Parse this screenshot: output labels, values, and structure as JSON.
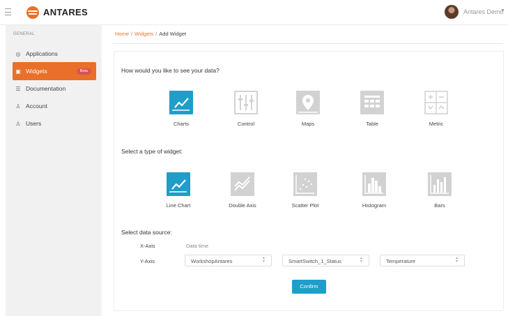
{
  "colors": {
    "accent": "#e8702a",
    "selected": "#1e9ec9",
    "icon_gray": "#d2d2d2",
    "badge": "#d9534f",
    "button": "#1e9ec9"
  },
  "header": {
    "brand": "ANTARES",
    "user": "Antares Demo"
  },
  "sidebar": {
    "heading": "GENERAL",
    "items": [
      {
        "label": "Applications",
        "icon": "applications-icon"
      },
      {
        "label": "Widgets",
        "icon": "widgets-icon",
        "badge": "Beta",
        "active": true
      },
      {
        "label": "Documentation",
        "icon": "documentation-icon"
      },
      {
        "label": "Account",
        "icon": "account-icon"
      },
      {
        "label": "Users",
        "icon": "users-icon"
      }
    ]
  },
  "breadcrumb": {
    "home": "Home",
    "widgets": "Widgets",
    "current": "Add Widget"
  },
  "main": {
    "question1": "How would you like to see your data?",
    "data_views": [
      {
        "label": "Charts",
        "icon": "line-chart-icon",
        "selected": true
      },
      {
        "label": "Control",
        "icon": "sliders-icon",
        "selected": false
      },
      {
        "label": "Maps",
        "icon": "map-pin-icon",
        "selected": false
      },
      {
        "label": "Table",
        "icon": "table-icon",
        "selected": false
      },
      {
        "label": "Metric",
        "icon": "metric-icon",
        "selected": false
      }
    ],
    "question2": "Select a type of widget:",
    "widget_types": [
      {
        "label": "Line Chart",
        "icon": "line-chart-icon",
        "selected": true
      },
      {
        "label": "Double Axis",
        "icon": "double-axis-icon",
        "selected": false
      },
      {
        "label": "Scatter Plot",
        "icon": "scatter-plot-icon",
        "selected": false
      },
      {
        "label": "Histogram",
        "icon": "histogram-icon",
        "selected": false
      },
      {
        "label": "Bars",
        "icon": "bars-icon",
        "selected": false
      }
    ],
    "question3": "Select data source:",
    "x_axis": {
      "label": "X-Axis",
      "value": "Data time"
    },
    "y_axis": {
      "label": "Y-Axis",
      "application": "WorkshopAntares",
      "device": "SmartSwitch_1_Status",
      "field": "Temperature"
    },
    "confirm_label": "Confirm"
  }
}
